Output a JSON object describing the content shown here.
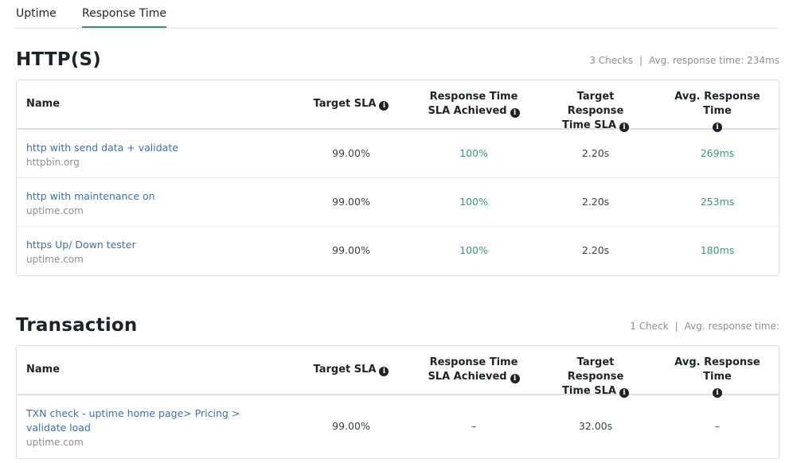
{
  "tabs": [
    {
      "label": "Uptime",
      "active": false
    },
    {
      "label": "Response Time",
      "active": true
    }
  ],
  "sections": [
    {
      "title": "HTTP(S)",
      "stats": {
        "checks": "3 Checks",
        "separator": "|",
        "avg": "Avg. response time: 234ms"
      },
      "columns": {
        "name": "Name",
        "target_sla": "Target SLA",
        "achieved_line1": "Response Time",
        "achieved_line2": "SLA Achieved",
        "target_rt_line1": "Target Response",
        "target_rt_line2": "Time SLA",
        "avg_rt": "Avg. Response Time"
      },
      "rows": [
        {
          "name": "http with send data + validate",
          "host": "httpbin.org",
          "target_sla": "99.00%",
          "achieved": "100%",
          "target_rt": "2.20s",
          "avg_rt": "269ms"
        },
        {
          "name": "http with maintenance on",
          "host": "uptime.com",
          "target_sla": "99.00%",
          "achieved": "100%",
          "target_rt": "2.20s",
          "avg_rt": "253ms"
        },
        {
          "name": "https Up/ Down tester",
          "host": "uptime.com",
          "target_sla": "99.00%",
          "achieved": "100%",
          "target_rt": "2.20s",
          "avg_rt": "180ms"
        }
      ]
    },
    {
      "title": "Transaction",
      "stats": {
        "checks": "1 Check",
        "separator": "|",
        "avg": "Avg. response time:"
      },
      "columns": {
        "name": "Name",
        "target_sla": "Target SLA",
        "achieved_line1": "Response Time",
        "achieved_line2": "SLA Achieved",
        "target_rt_line1": "Target Response",
        "target_rt_line2": "Time SLA",
        "avg_rt": "Avg. Response Time"
      },
      "rows": [
        {
          "name": "TXN check - uptime home page> Pricing > validate load",
          "host": "uptime.com",
          "target_sla": "99.00%",
          "achieved": "–",
          "target_rt": "32.00s",
          "avg_rt": "–"
        }
      ]
    }
  ],
  "colors": {
    "accent": "#3a8a89",
    "link": "#3b6fb0",
    "success": "#3a9a6a"
  },
  "icons": {
    "info": "info-circle-icon"
  }
}
